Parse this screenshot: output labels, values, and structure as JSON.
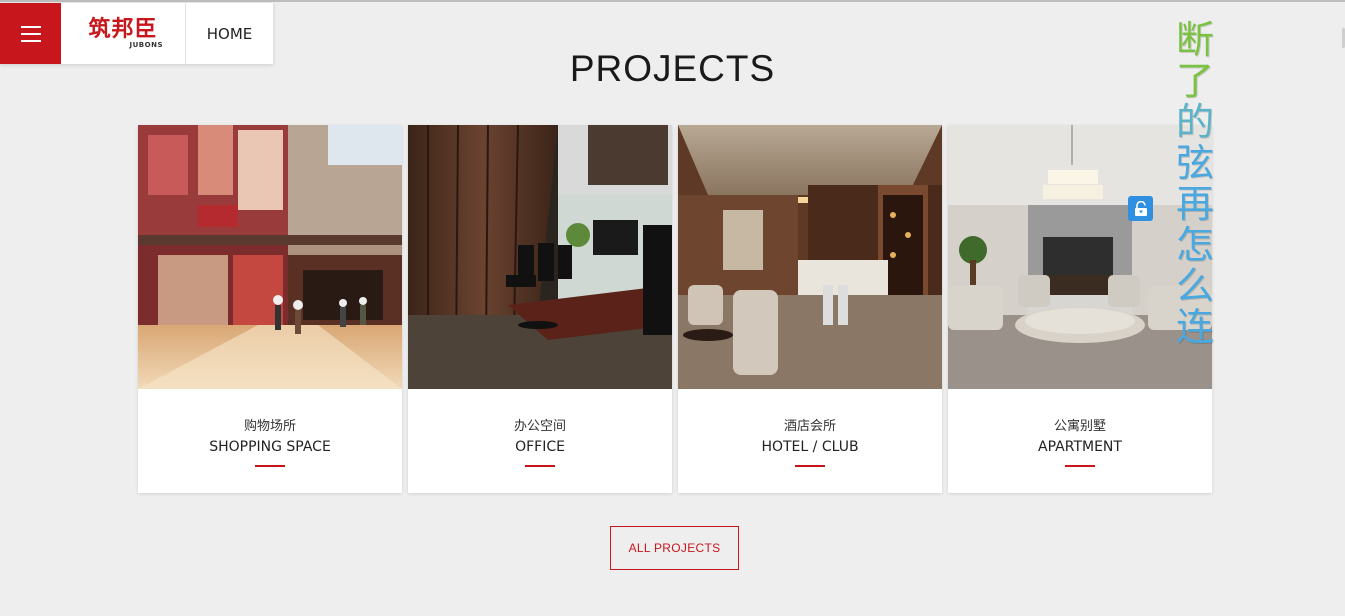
{
  "header": {
    "logo_cn": "筑邦臣",
    "logo_en": "JUBONS",
    "home_label": "HOME"
  },
  "section": {
    "title": "PROJECTS"
  },
  "cards": [
    {
      "cn": "购物场所",
      "en": "SHOPPING SPACE"
    },
    {
      "cn": "办公空间",
      "en": "OFFICE"
    },
    {
      "cn": "酒店会所",
      "en": "HOTEL / CLUB"
    },
    {
      "cn": "公寓别墅",
      "en": "APARTMENT"
    }
  ],
  "all_projects_label": "ALL PROJECTS",
  "overlay": {
    "chars": [
      "断",
      "了",
      "的",
      "弦",
      "再",
      "怎",
      "么",
      "连"
    ]
  },
  "icons": {
    "menu": "hamburger-menu-icon",
    "lock": "unlock-icon"
  },
  "colors": {
    "brand": "#c8161d",
    "background": "#eeeeee",
    "overlay_green": "#7cc242",
    "overlay_blue": "#4aa8e0"
  }
}
